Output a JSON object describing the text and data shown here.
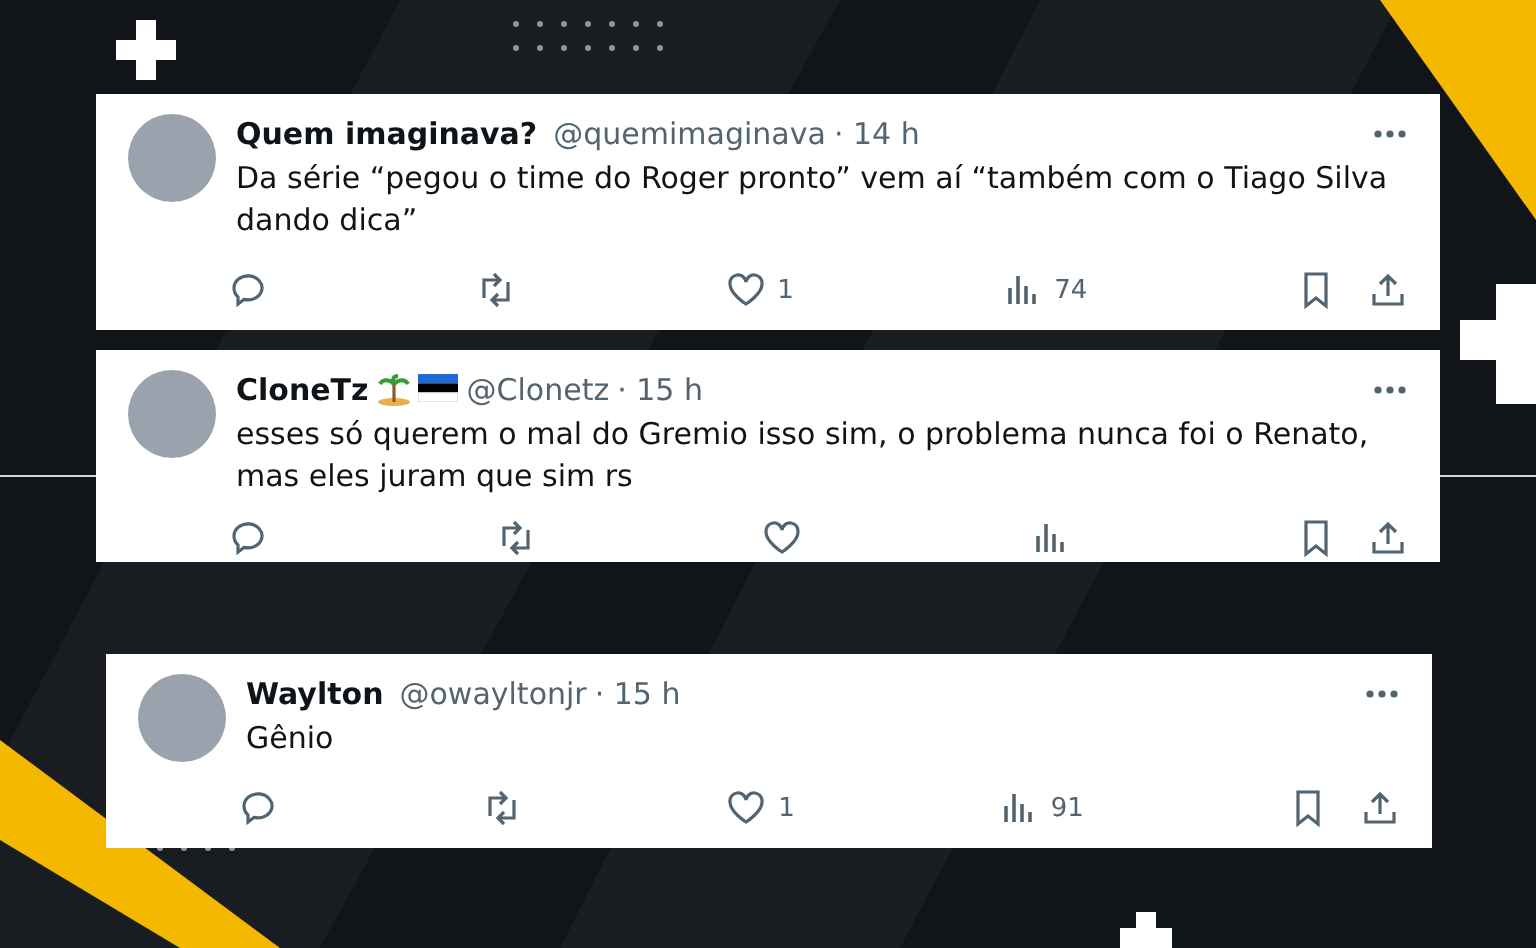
{
  "tweets": [
    {
      "name": "Quem imaginava?",
      "handle": "@quemimaginava",
      "time": "· 14 h",
      "text": "Da série “pegou o time do Roger pronto” vem aí “também com o Tiago Silva dando dica”",
      "likes": "1",
      "views": "74",
      "actions_cut": false
    },
    {
      "name": "CloneTz",
      "handle": "@Clonetz",
      "time": "· 15 h",
      "text": "esses só querem o mal do Gremio isso sim, o problema nunca foi o Renato, mas eles juram que sim rs",
      "badges": [
        {
          "kind": "island"
        },
        {
          "kind": "flag"
        }
      ],
      "actions_cut": true
    },
    {
      "name": "Waylton",
      "handle": "@owayltonjr",
      "time": "· 15 h",
      "text": "Gênio",
      "likes": "1",
      "views": "91",
      "actions_cut": false
    }
  ]
}
